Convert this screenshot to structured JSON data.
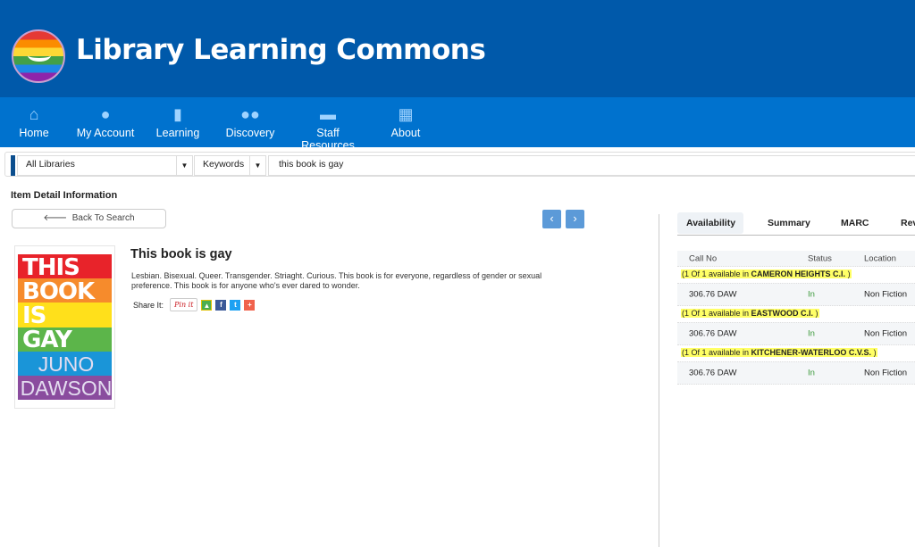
{
  "header": {
    "title": "Library Learning Commons",
    "logo": "rainbow-school-board-logo"
  },
  "nav": [
    {
      "label": "Home",
      "icon": "home-icon"
    },
    {
      "label": "My Account",
      "icon": "user-icon"
    },
    {
      "label": "Learning",
      "icon": "bar-chart-icon"
    },
    {
      "label": "Discovery",
      "icon": "users-icon"
    },
    {
      "label": "Staff Resources",
      "icon": "briefcase-icon"
    },
    {
      "label": "About",
      "icon": "grid-icon"
    }
  ],
  "search": {
    "library": "All Libraries",
    "field": "Keywords",
    "query": "this book is gay"
  },
  "page": {
    "heading": "Item Detail Information",
    "back_label": "Back To Search",
    "prev": "‹",
    "next": "›"
  },
  "item": {
    "title": "This book is gay",
    "description": "Lesbian. Bisexual. Queer. Transgender. Striaght. Curious. This book is for everyone, regardless of gender or sexual preference. This book is for anyone who's ever dared to wonder.",
    "share_label": "Share It:",
    "pinit": "Pin it",
    "cover": {
      "title_lines": [
        "THIS",
        "BOOK",
        "IS",
        "GAY"
      ],
      "author": "JUNO DAWSON",
      "colors": [
        "#e8232a",
        "#f68b2c",
        "#ffe01b",
        "#5cb54a",
        "#1a95d8",
        "#8a4c9e"
      ]
    }
  },
  "tabs": [
    "Availability",
    "Summary",
    "MARC",
    "Rev"
  ],
  "availability": {
    "columns": [
      "Call No",
      "Status",
      "Location"
    ],
    "groups": [
      {
        "prefix": "(1 Of 1 available in ",
        "library": "CAMERON HEIGHTS C.I.",
        "suffix": " )",
        "call_no": "306.76 DAW",
        "status": "In",
        "location": "Non Fiction"
      },
      {
        "prefix": "(1 Of 1 available in ",
        "library": "EASTWOOD C.I.",
        "suffix": " )",
        "call_no": "306.76 DAW",
        "status": "In",
        "location": "Non Fiction"
      },
      {
        "prefix": "(1 Of 1 available in ",
        "library": "KITCHENER-WATERLOO C.V.S.",
        "suffix": " )",
        "call_no": "306.76 DAW",
        "status": "In",
        "location": "Non Fiction"
      }
    ]
  }
}
